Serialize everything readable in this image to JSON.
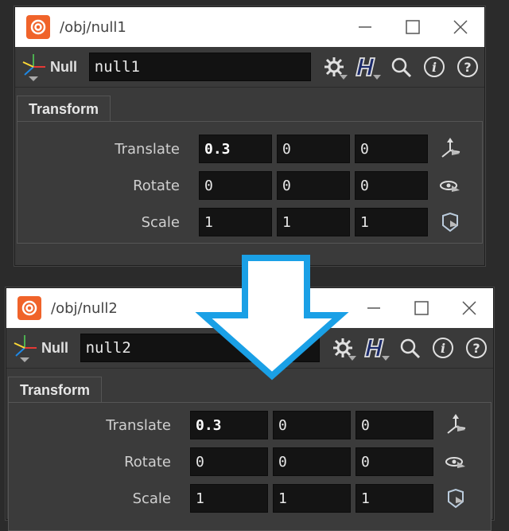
{
  "windows": [
    {
      "title": "/obj/null1",
      "node_type": "Null",
      "node_name": "null1",
      "tab": "Transform",
      "params": [
        {
          "label": "Translate",
          "values": [
            "0.3",
            "0",
            "0"
          ]
        },
        {
          "label": "Rotate",
          "values": [
            "0",
            "0",
            "0"
          ]
        },
        {
          "label": "Scale",
          "values": [
            "1",
            "1",
            "1"
          ]
        }
      ]
    },
    {
      "title": "/obj/null2",
      "node_type": "Null",
      "node_name": "null2",
      "tab": "Transform",
      "params": [
        {
          "label": "Translate",
          "values": [
            "0.3",
            "0",
            "0"
          ]
        },
        {
          "label": "Rotate",
          "values": [
            "0",
            "0",
            "0"
          ]
        },
        {
          "label": "Scale",
          "values": [
            "1",
            "1",
            "1"
          ]
        }
      ]
    }
  ],
  "icons": {
    "app": "houdini-logo-icon",
    "minimize": "minimize-icon",
    "maximize": "maximize-icon",
    "close": "close-icon",
    "gear": "gear-icon",
    "help_h": "help-browser-icon",
    "search": "search-icon",
    "info": "info-icon",
    "help": "question-icon",
    "translate_handle": "translate-handle-icon",
    "rotate_handle": "rotate-handle-icon",
    "scale_handle": "scale-handle-icon",
    "transition": "down-arrow-icon"
  },
  "colors": {
    "accent_arrow": "#1aa0e6",
    "houdini_orange": "#f0632a"
  }
}
